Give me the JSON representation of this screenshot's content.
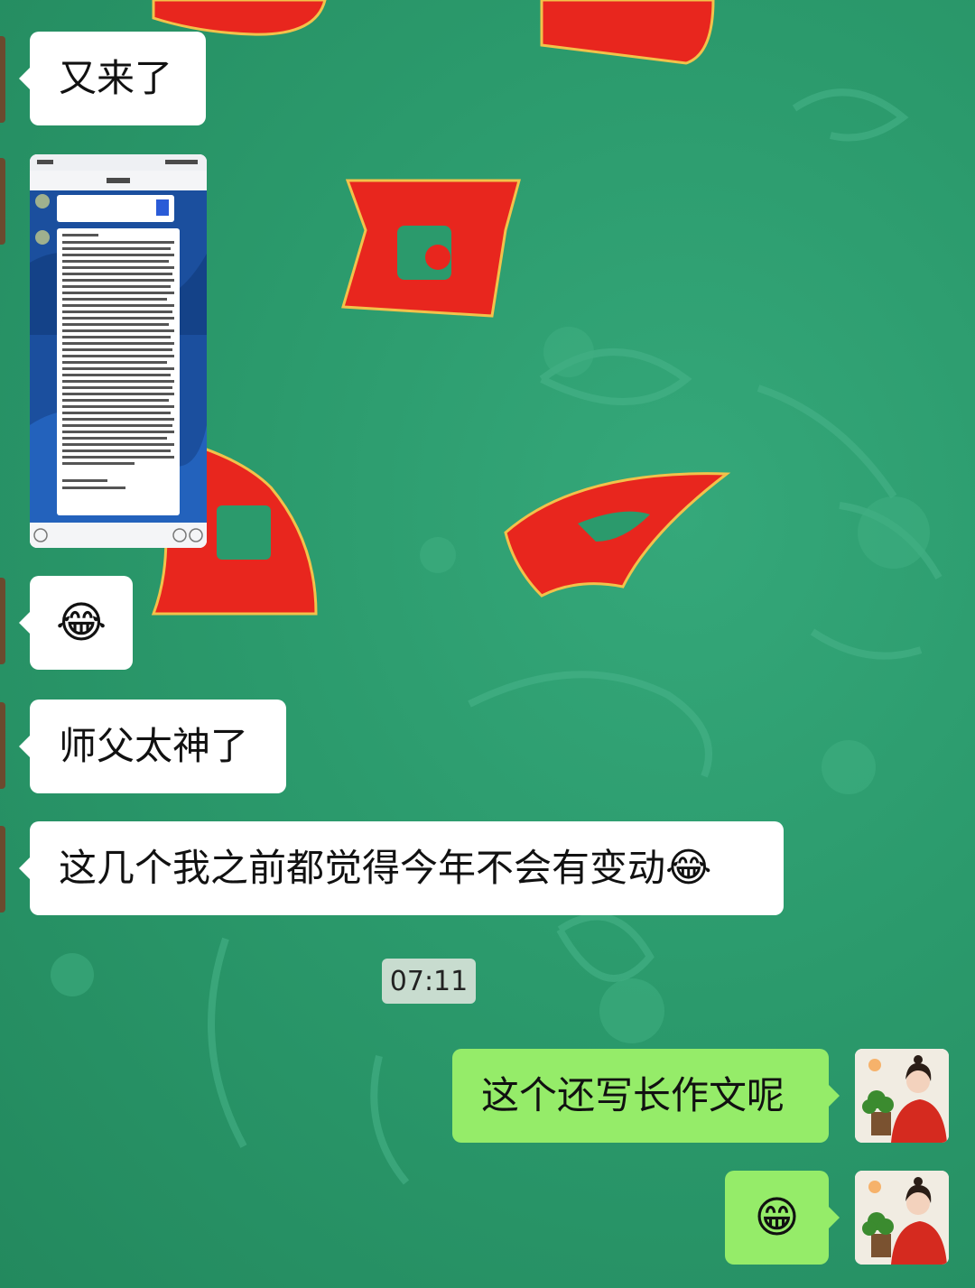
{
  "messages": [
    {
      "side": "left",
      "type": "text",
      "text": "又来了"
    },
    {
      "side": "left",
      "type": "image",
      "icon": "phone-screenshot-thumbnail"
    },
    {
      "side": "left",
      "type": "emoji",
      "emoji": "😂"
    },
    {
      "side": "left",
      "type": "text",
      "text": "师父太神了"
    },
    {
      "side": "left",
      "type": "text",
      "text": "这几个我之前都觉得今年不会有变动",
      "emoji": "😂"
    },
    {
      "side": "center",
      "type": "timestamp",
      "text": "07:11"
    },
    {
      "side": "right",
      "type": "text",
      "text": "这个还写长作文呢"
    },
    {
      "side": "right",
      "type": "emoji",
      "emoji": "😁"
    }
  ],
  "colors": {
    "sent_bubble": "#95ec69",
    "received_bubble": "#ffffff",
    "background": "#2b9a6c",
    "ornament_red": "#e8261e"
  }
}
